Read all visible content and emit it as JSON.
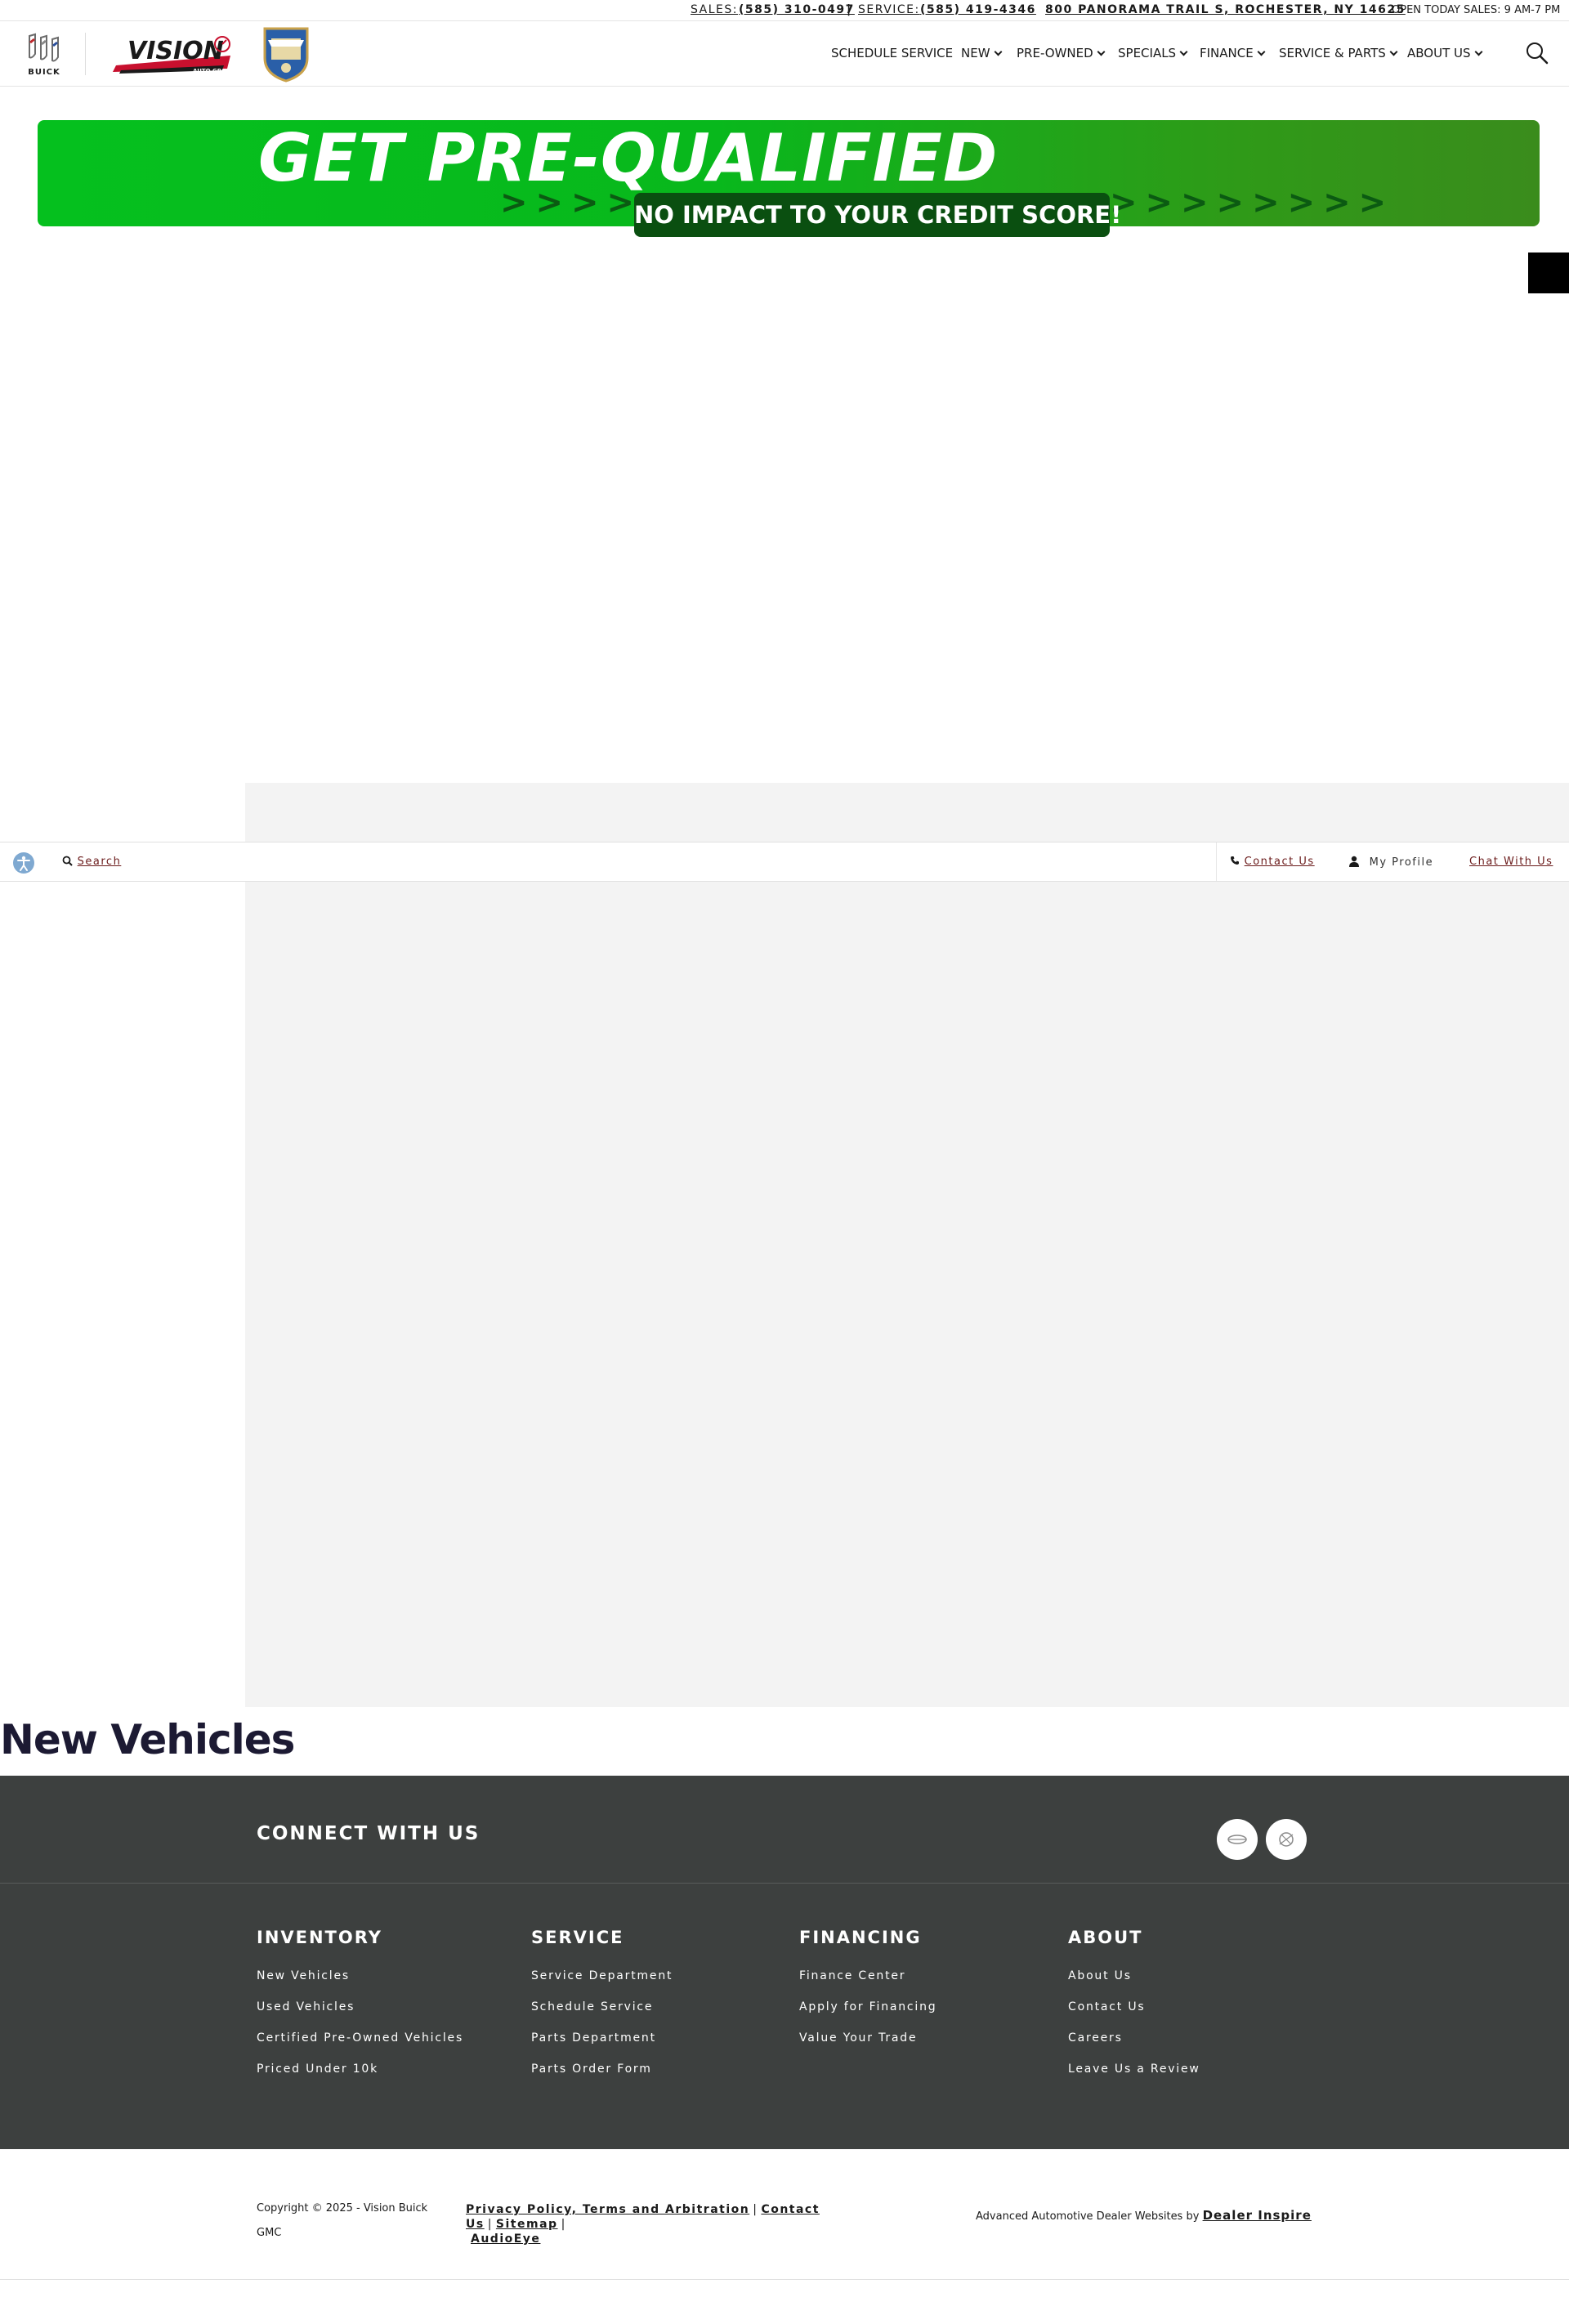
{
  "topbar": {
    "sales_label": "SALES:",
    "sales_phone": "(585) 310-0497",
    "divider": "|",
    "service_label": "SERVICE:",
    "service_phone": "(585) 419-4346",
    "address": "800 PANORAMA TRAIL S, ROCHESTER, NY 14625",
    "hours": "OPEN TODAY SALES: 9 AM-7 PM"
  },
  "header": {
    "buick_word": "BUICK",
    "vision_word": "VISION",
    "vision_sub": "AUTO GROUP",
    "nav": [
      {
        "label": "SCHEDULE SERVICE"
      },
      {
        "label": "NEW"
      },
      {
        "label": "PRE-OWNED"
      },
      {
        "label": "SPECIALS"
      },
      {
        "label": "FINANCE"
      },
      {
        "label": "SERVICE & PARTS"
      },
      {
        "label": "ABOUT US"
      }
    ]
  },
  "banner": {
    "title": "GET PRE-QUALIFIED",
    "arrows_left": ">>>>",
    "arrows_right": ">>>>>>>>",
    "pill": "NO IMPACT TO YOUR CREDIT SCORE!",
    "green": "#05c01e",
    "dark_green": "#0a4f10"
  },
  "stickybar": {
    "search": "Search",
    "contact_us": "Contact Us",
    "my_profile": "My Profile",
    "chat": "Chat With Us"
  },
  "main": {
    "heading": "New Vehicles"
  },
  "footer": {
    "connect_title": "CONNECT WITH US",
    "columns": [
      {
        "heading": "INVENTORY",
        "links": [
          "New Vehicles",
          "Used Vehicles",
          "Certified Pre-Owned Vehicles",
          "Priced Under 10k"
        ]
      },
      {
        "heading": "SERVICE",
        "links": [
          "Service Department",
          "Schedule Service",
          "Parts Department",
          "Parts Order Form"
        ]
      },
      {
        "heading": "FINANCING",
        "links": [
          "Finance Center",
          "Apply for Financing",
          "Value Your Trade"
        ]
      },
      {
        "heading": "ABOUT",
        "links": [
          "About Us",
          "Contact Us",
          "Careers",
          "Leave Us a Review"
        ]
      }
    ],
    "copyright": "Copyright © 2025 - Vision Buick GMC",
    "legal": [
      "Privacy Policy, Terms and Arbitration",
      "Contact Us",
      "Sitemap",
      "AudioEye"
    ],
    "credit_prefix": "Advanced Automotive Dealer Websites by",
    "credit_brand": "Dealer Inspire",
    "bg_color": "#3d403f"
  }
}
